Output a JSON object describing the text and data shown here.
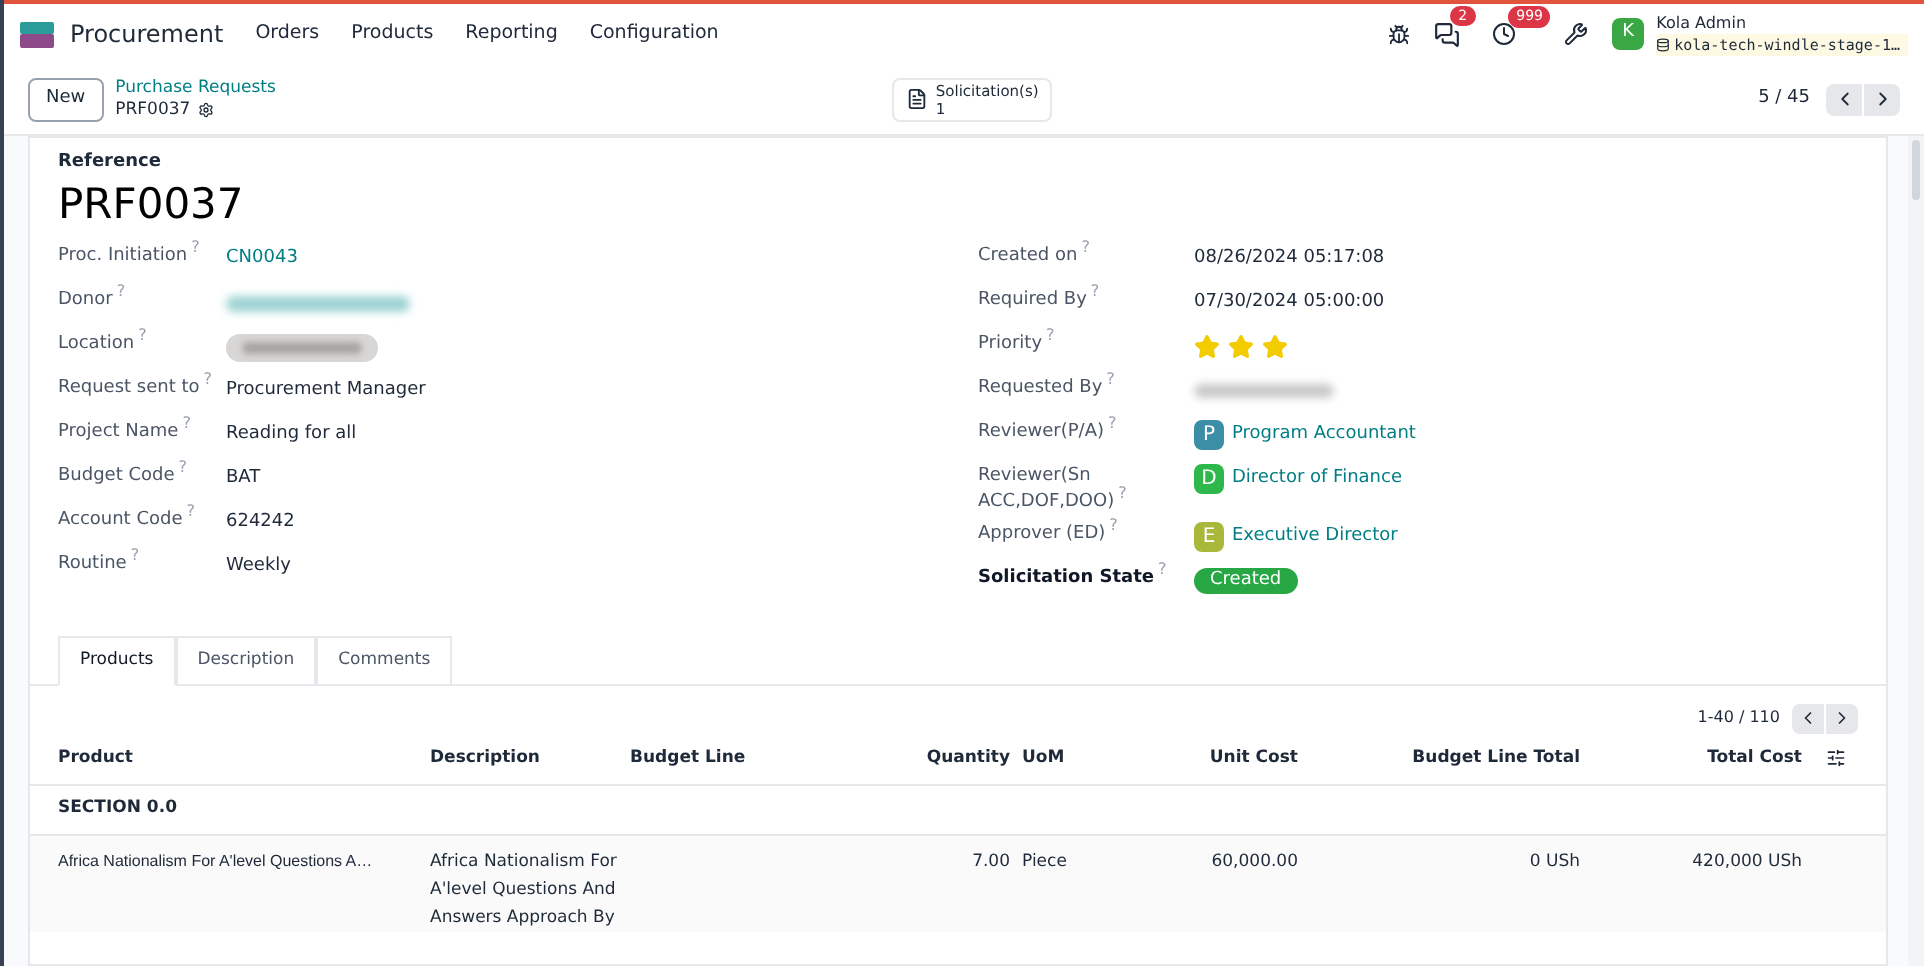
{
  "navbar": {
    "app": "Procurement",
    "menu": [
      "Orders",
      "Products",
      "Reporting",
      "Configuration"
    ],
    "messages_count": "2",
    "activities_count": "999",
    "user_initial": "K",
    "user_name": "Kola Admin",
    "database": "kola-tech-windle-stage-1…"
  },
  "control_panel": {
    "new_button": "New",
    "breadcrumb": "Purchase Requests",
    "record": "PRF0037",
    "smart_button": {
      "label": "Solicitation(s)",
      "count": "1"
    },
    "pager": "5 / 45"
  },
  "form": {
    "reference_label": "Reference",
    "reference": "PRF0037",
    "left_fields": [
      {
        "label": "Proc. Initiation",
        "help": "?",
        "kind": "link",
        "value": "CN0043"
      },
      {
        "label": "Donor",
        "help": "?",
        "kind": "blurred_link"
      },
      {
        "label": "Location",
        "help": "?",
        "kind": "blurred_tag"
      },
      {
        "label": "Request sent to",
        "help": "?",
        "kind": "text",
        "value": "Procurement Manager"
      },
      {
        "label": "Project Name",
        "help": "?",
        "kind": "text",
        "value": "Reading for all"
      },
      {
        "label": "Budget Code",
        "help": "?",
        "kind": "text",
        "value": "BAT"
      },
      {
        "label": "Account Code",
        "help": "?",
        "kind": "text",
        "value": "624242"
      },
      {
        "label": "Routine",
        "help": "?",
        "kind": "text",
        "value": "Weekly"
      }
    ],
    "right_fields": [
      {
        "label": "Created on",
        "help": "?",
        "kind": "text",
        "value": "08/26/2024 05:17:08"
      },
      {
        "label": "Required By",
        "help": "?",
        "kind": "text",
        "value": "07/30/2024 05:00:00"
      },
      {
        "label": "Priority",
        "help": "?",
        "kind": "stars",
        "stars": 3
      },
      {
        "label": "Requested By",
        "help": "?",
        "kind": "blurred_text"
      },
      {
        "label": "Reviewer(P/A)",
        "help": "?",
        "kind": "user",
        "initial": "P",
        "value": "Program Accountant",
        "color": "#3b8ea5"
      },
      {
        "label": "Reviewer(Sn ACC,DOF,DOO)",
        "help": "?",
        "kind": "user",
        "initial": "D",
        "value": "Director of Finance",
        "color": "#2eb84b"
      },
      {
        "label": "Approver (ED)",
        "help": "?",
        "kind": "user",
        "initial": "E",
        "value": "Executive Director",
        "color": "#a8b83a"
      },
      {
        "label": "Solicitation State",
        "help": "?",
        "kind": "badge",
        "value": "Created",
        "bold": true
      }
    ],
    "tabs": [
      {
        "label": "Products",
        "selected": true
      },
      {
        "label": "Description",
        "selected": false
      },
      {
        "label": "Comments",
        "selected": false
      }
    ],
    "table": {
      "pager": "1-40 / 110",
      "columns": [
        "Product",
        "Description",
        "Budget Line",
        "Quantity",
        "UoM",
        "Unit Cost",
        "Budget Line Total",
        "Total Cost"
      ],
      "section": "SECTION 0.0",
      "rows": [
        {
          "product": "Africa Nationalism For A'level Questions A…",
          "description": "Africa Nationalism For A'level Questions And Answers Approach By",
          "budget_line": "",
          "quantity": "7.00",
          "uom": "Piece",
          "unit_cost": "60,000.00",
          "budget_line_total": "0 USh",
          "total_cost": "420,000 USh"
        }
      ]
    }
  }
}
